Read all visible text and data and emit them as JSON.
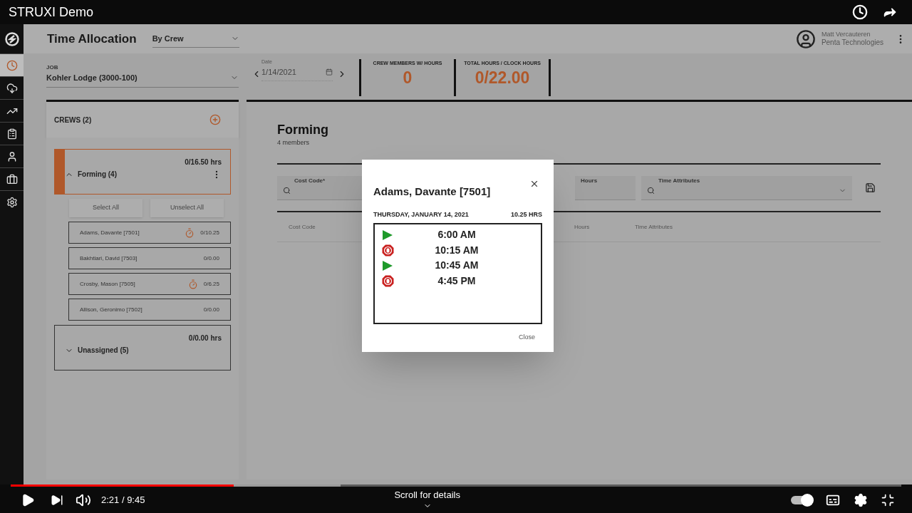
{
  "player": {
    "title": "STRUXI Demo",
    "time": "2:21 / 9:45",
    "scroll_hint": "Scroll for details",
    "progress": {
      "level": 0.25
    },
    "buffered": {
      "level": 0.37
    },
    "autoplay": {
      "on": true
    }
  },
  "app": {
    "nav": [
      {
        "selected": true
      },
      {
        "selected": false
      },
      {
        "selected": false
      },
      {
        "selected": false
      },
      {
        "selected": false
      },
      {
        "selected": false
      },
      {
        "selected": false
      }
    ],
    "header": {
      "title": "Time Allocation",
      "view": "By Crew",
      "user_name": "Matt Vercauteren",
      "company": "Penta Technologies"
    },
    "job": {
      "label": "JOB",
      "value": "Kohler Lodge (3000-100)"
    },
    "date": {
      "label": "Date",
      "value": "1/14/2021"
    },
    "stats": [
      {
        "label": "CREW MEMBERS W/ HOURS",
        "value": "0"
      },
      {
        "label": "TOTAL HOURS / CLOCK HOURS",
        "value": "0/22.00"
      }
    ],
    "crews": {
      "title": "CREWS (2)",
      "groups": [
        {
          "name": "Forming (4)",
          "hours": "0/16.50 hrs",
          "expanded": true,
          "selected": true,
          "actions": [
            "Select All",
            "Unselect All"
          ],
          "members": [
            {
              "name": "Adams, Davante [7501]",
              "hours": "0/10.25",
              "clocked": true
            },
            {
              "name": "Bakhtiari, David [7503]",
              "hours": "0/0.00",
              "clocked": false
            },
            {
              "name": "Crosby, Mason [7505]",
              "hours": "0/6.25",
              "clocked": true
            },
            {
              "name": "Allison, Geronimo [7502]",
              "hours": "0/0.00",
              "clocked": false
            }
          ]
        },
        {
          "name": "Unassigned (5)",
          "hours": "0/0.00 hrs",
          "expanded": false,
          "selected": false
        }
      ]
    },
    "crew_detail": {
      "title": "Forming",
      "subtitle": "4 members",
      "fields": [
        {
          "label": "Cost Code*",
          "kind": "search"
        },
        {
          "label": "Hours",
          "kind": "text"
        },
        {
          "label": "Time Attributes",
          "kind": "search_select"
        }
      ],
      "columns": [
        "Cost Code",
        "Hours",
        "Time Attributes"
      ]
    },
    "modal": {
      "title": "Adams, Davante [7501]",
      "date": "THURSDAY, JANUARY 14, 2021",
      "total": "10.25 HRS",
      "close": "Close",
      "punches": [
        {
          "kind": "in",
          "time": "6:00 AM"
        },
        {
          "kind": "out",
          "time": "10:15 AM"
        },
        {
          "kind": "in",
          "time": "10:45 AM"
        },
        {
          "kind": "out",
          "time": "4:45 PM"
        }
      ]
    }
  }
}
